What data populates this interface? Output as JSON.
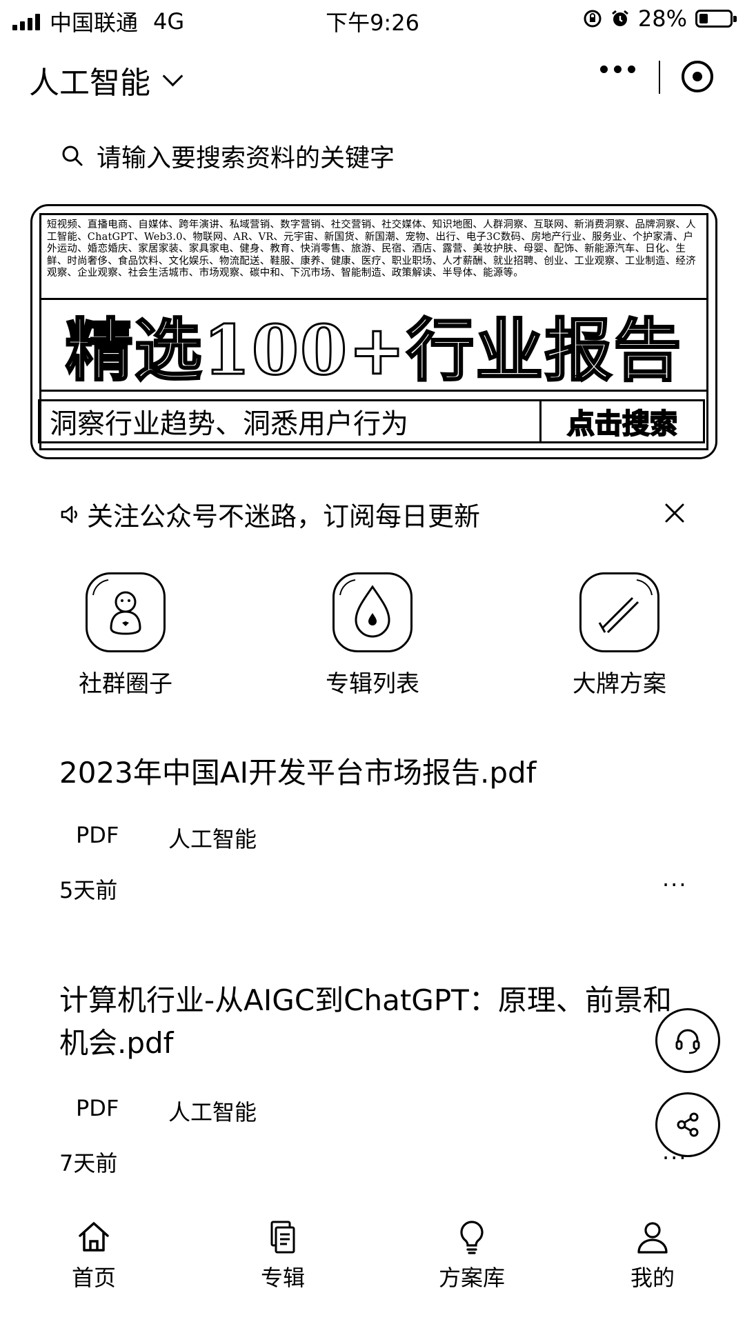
{
  "status_bar": {
    "carrier": "中国联通",
    "network": "4G",
    "time": "下午9:26",
    "battery_percent": "28%",
    "battery_level": 0.28
  },
  "header": {
    "title": "人工智能"
  },
  "search": {
    "placeholder": "请输入要搜索资料的关键字"
  },
  "banner": {
    "tags": "短视频、直播电商、自媒体、跨年演讲、私域营销、数字营销、社交营销、社交媒体、知识地图、人群洞察、互联网、新消费洞察、品牌洞察、人工智能、ChatGPT、Web3.0、物联网、AR、VR、元宇宙、新国货、新国潮、宠物、出行、电子3C数码、房地产行业、服务业、个护家清、户外运动、婚恋婚庆、家居家装、家具家电、健身、教育、快消零售、旅游、民宿、酒店、露营、美妆护肤、母婴、配饰、新能源汽车、日化、生鲜、时尚奢侈、食品饮料、文化娱乐、物流配送、鞋服、康养、健康、医疗、职业职场、人才薪酬、就业招聘、创业、工业观察、工业制造、经济观察、企业观察、社会生活城市、市场观察、碳中和、下沉市场、智能制造、政策解读、半导体、能源等。",
    "headline": "精选100+行业报告",
    "subline": "洞察行业趋势、洞悉用户行为",
    "cta": "点击搜索"
  },
  "notice": {
    "text": "关注公众号不迷路，订阅每日更新"
  },
  "quick_nav": [
    {
      "label": "社群圈子",
      "icon": "community-icon"
    },
    {
      "label": "专辑列表",
      "icon": "album-icon"
    },
    {
      "label": "大牌方案",
      "icon": "brand-plan-icon"
    }
  ],
  "articles": [
    {
      "title": "2023年中国AI开发平台市场报告.pdf",
      "type": "PDF",
      "category": "人工智能",
      "time": "5天前",
      "more": "···"
    },
    {
      "title": "计算机行业-从AIGC到ChatGPT：原理、前景和机会.pdf",
      "type": "PDF",
      "category": "人工智能",
      "time": "7天前",
      "more": "···"
    }
  ],
  "tabbar": [
    {
      "label": "首页",
      "icon": "home-icon"
    },
    {
      "label": "专辑",
      "icon": "album-tab-icon"
    },
    {
      "label": "方案库",
      "icon": "lightbulb-icon"
    },
    {
      "label": "我的",
      "icon": "user-icon"
    }
  ]
}
